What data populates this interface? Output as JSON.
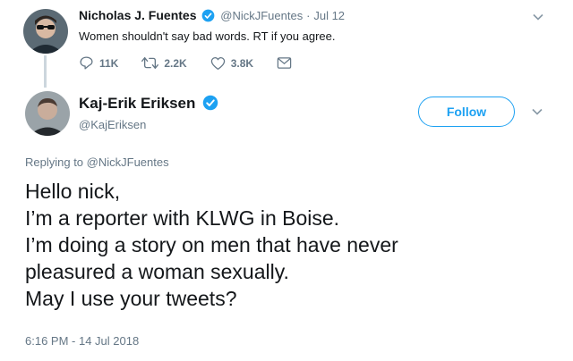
{
  "parent_tweet": {
    "author_name": "Nicholas J. Fuentes",
    "handle": "@NickJFuentes",
    "separator": "·",
    "date": "Jul 12",
    "text": "Women shouldn't say bad words. RT if you agree.",
    "reply_count": "11K",
    "retweet_count": "2.2K",
    "like_count": "3.8K"
  },
  "main_tweet": {
    "author_name": "Kaj-Erik Eriksen",
    "handle": "@KajEriksen",
    "follow_label": "Follow",
    "replying_to": "Replying to @NickJFuentes",
    "lines": [
      "Hello nick,",
      "I’m a reporter with KLWG in Boise.",
      "I’m doing a story on men that have never",
      "pleasured a woman sexually.",
      "May I use your tweets?"
    ],
    "timestamp": "6:16 PM - 14 Jul 2018"
  },
  "colors": {
    "accent": "#1da1f2",
    "muted": "#657786",
    "thread_line": "#ccd6dd"
  }
}
